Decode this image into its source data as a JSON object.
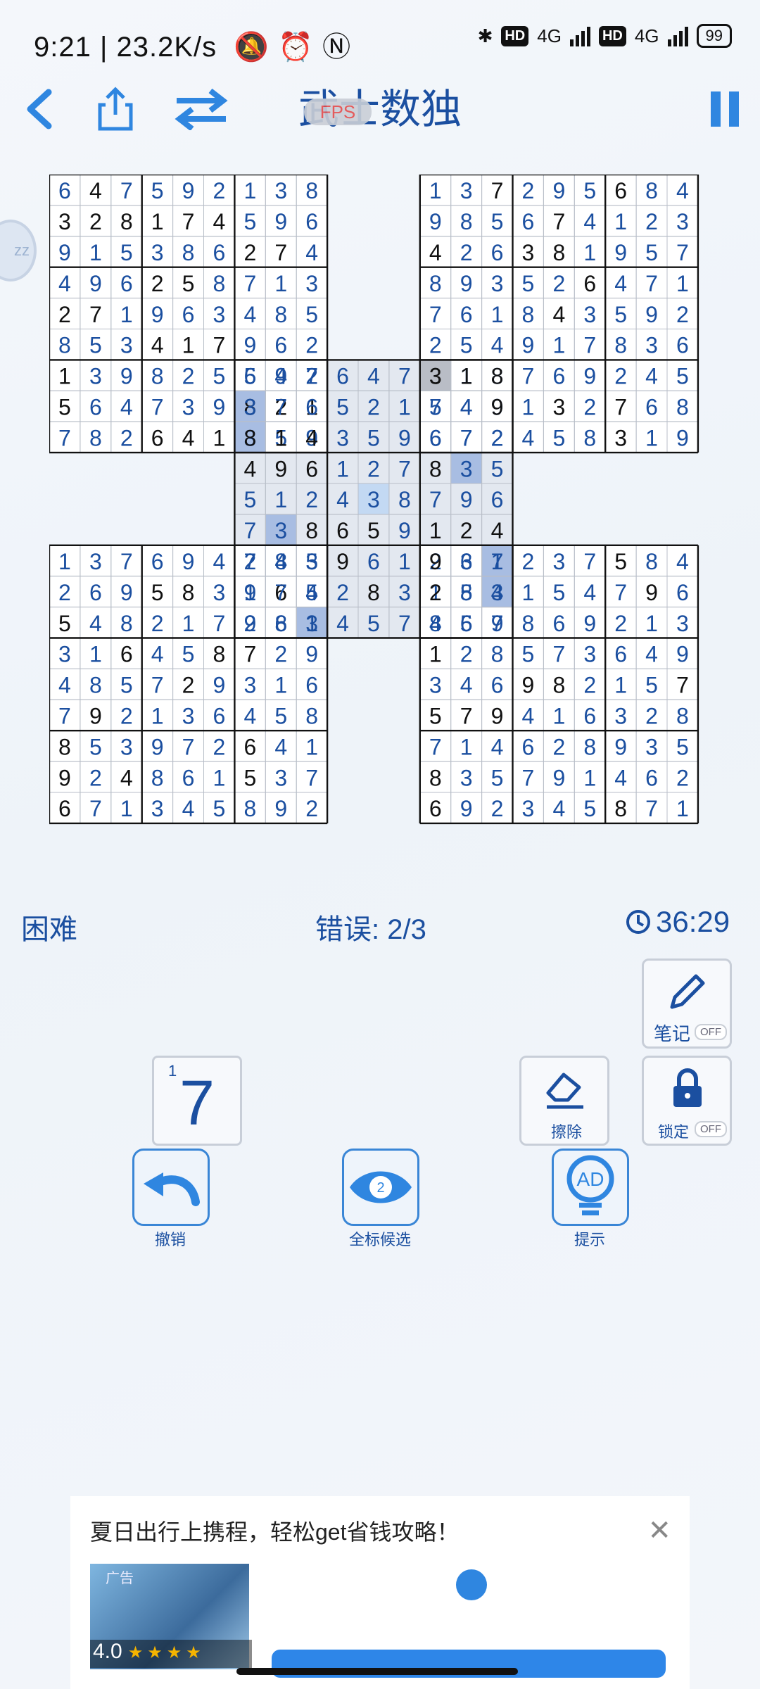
{
  "status_bar": {
    "time": "9:21",
    "speed": "23.2K/s",
    "hd": "HD",
    "net": "4G",
    "battery": "99"
  },
  "app": {
    "title": "武士数独",
    "fps_badge": "FPS"
  },
  "side_bubble": "zz",
  "board": {
    "grids": [
      {
        "rows": [
          "647592138",
          "328174596",
          "915386274",
          "496258713",
          "271963485",
          "853417962",
          "139825647",
          "564739821",
          "782641359"
        ],
        "blue": [
          "101111111",
          "000000111",
          "111111001",
          "111001111",
          "001111111",
          "111000111",
          "011111111",
          "011111000",
          "111000111"
        ]
      },
      {
        "rows": [
          "137295684",
          "985674123",
          "426381957",
          "893526471",
          "761843592",
          "254917836",
          "318769245",
          "549132768",
          "672458319"
        ],
        "blue": [
          "110111011",
          "111101111",
          "011001111",
          "111110111",
          "111101111",
          "111111111",
          "011111111",
          "111101011",
          "111111011"
        ]
      },
      {
        "rows": [
          "592647318",
          "376521749",
          "814359672",
          "496127835",
          "512438796",
          "738659124",
          "743961237",
          "965283154",
          "281457869"
        ],
        "blue": [
          "111111000",
          "111111110",
          "000111111",
          "000111011",
          "111111111",
          "110001000",
          "111011111",
          "101101111",
          "111111111"
        ]
      },
      {
        "rows": [
          "137694285",
          "269583174",
          "548217963",
          "316458729",
          "485729316",
          "792136458",
          "853972641",
          "924861537",
          "671345892"
        ],
        "blue": [
          "111111111",
          "111001111",
          "011111111",
          "110110011",
          "111101111",
          "101111111",
          "011111011",
          "010111011",
          "011111111"
        ]
      },
      {
        "rows": [
          "961237584",
          "283154796",
          "457869213",
          "128573649",
          "346982157",
          "579416328",
          "714628935",
          "835791462",
          "692345871"
        ],
        "blue": [
          "011111011",
          "011111101",
          "111111111",
          "011111111",
          "111001110",
          "000111111",
          "111111111",
          "011111111",
          "011111011"
        ]
      }
    ],
    "highlights": [
      {
        "grid": 0,
        "row": 8,
        "col": 6,
        "shade": "dark"
      },
      {
        "grid": 1,
        "row": 6,
        "col": 0,
        "shade": "gray"
      },
      {
        "grid": 2,
        "row": 1,
        "col": 0,
        "shade": "dark"
      },
      {
        "grid": 2,
        "row": 4,
        "col": 4,
        "shade": "light"
      },
      {
        "grid": 2,
        "row": 3,
        "col": 7,
        "shade": "dark"
      },
      {
        "grid": 2,
        "row": 5,
        "col": 1,
        "shade": "dark"
      },
      {
        "grid": 2,
        "row": 6,
        "col": 8,
        "shade": "dark"
      },
      {
        "grid": 3,
        "row": 2,
        "col": 8,
        "shade": "dark"
      },
      {
        "grid": 4,
        "row": 1,
        "col": 2,
        "shade": "dark"
      }
    ],
    "colors": {
      "given": "#111111",
      "entered": "#1b4fa0",
      "dark": "#a8bde2",
      "light": "#c3d9f3",
      "gray": "#b9bdc6",
      "region": "#e3e8f0"
    }
  },
  "info": {
    "difficulty": "困难",
    "errors": "错误: 2/3",
    "timer": "36:29"
  },
  "tools": {
    "notes": "笔记",
    "erase": "擦除",
    "lock": "锁定",
    "off": "OFF"
  },
  "number_card": {
    "count": "1",
    "digit": "7"
  },
  "actions": {
    "undo": "撤销",
    "show_candidates": "全标候选",
    "hint": "提示",
    "candidates_badge": "2",
    "hint_badge": "AD"
  },
  "ad": {
    "title": "夏日出行上携程，轻松get省钱攻略！",
    "label": "广告",
    "rating": "4.0",
    "stars": "★★★★"
  }
}
